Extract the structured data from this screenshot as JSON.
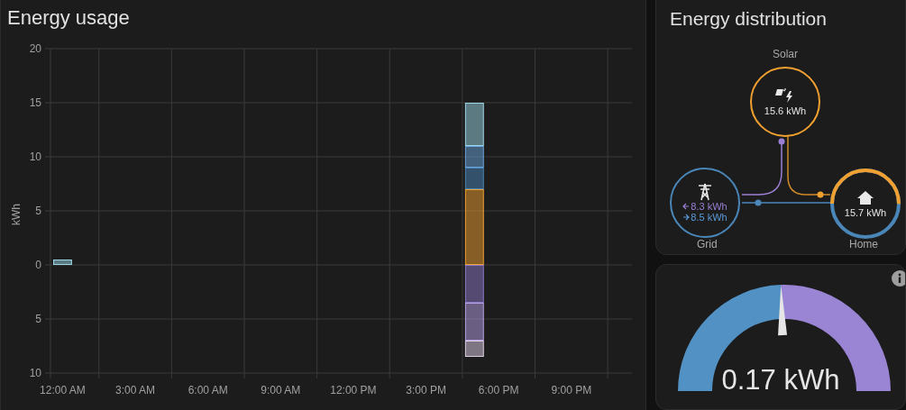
{
  "energy_usage": {
    "title": "Energy usage",
    "chart_data": {
      "type": "bar",
      "stacked": true,
      "ylabel": "kWh",
      "x": [
        0,
        17
      ],
      "xticks": [
        {
          "value": 0,
          "label": "12:00 AM"
        },
        {
          "value": 3,
          "label": "3:00 AM"
        },
        {
          "value": 6,
          "label": "6:00 AM"
        },
        {
          "value": 9,
          "label": "9:00 AM"
        },
        {
          "value": 12,
          "label": "12:00 PM"
        },
        {
          "value": 15,
          "label": "3:00 PM"
        },
        {
          "value": 18,
          "label": "6:00 PM"
        },
        {
          "value": 21,
          "label": "9:00 PM"
        }
      ],
      "xlim": [
        -0.5,
        23.5
      ],
      "ylim": [
        -10,
        20
      ],
      "grid": true,
      "yticks": [
        {
          "value": -10,
          "label": "10"
        },
        {
          "value": -5,
          "label": "5"
        },
        0,
        5,
        10,
        15,
        20
      ],
      "series": [
        {
          "color": "#f0a030",
          "values": [
            null,
            7
          ]
        },
        {
          "color": "#4a86b8",
          "values": [
            null,
            2
          ]
        },
        {
          "color": "#6aa4dc",
          "values": [
            null,
            2
          ]
        },
        {
          "color": "#9cd8e8",
          "values": [
            0.5,
            4
          ]
        },
        {
          "color": "#8c78c8",
          "values": [
            null,
            -3.5
          ]
        },
        {
          "color": "#b8a0e8",
          "values": [
            null,
            -3.5
          ]
        },
        {
          "color": "#e0d0e8",
          "values": [
            null,
            -1.5
          ]
        }
      ]
    }
  },
  "energy_distribution": {
    "title": "Energy distribution",
    "solar": {
      "label": "Solar",
      "value": "15.6 kWh"
    },
    "grid": {
      "label": "Grid",
      "from_grid": "8.3 kWh",
      "to_grid": "8.5 kWh"
    },
    "home": {
      "label": "Home",
      "value": "15.7 kWh",
      "level": 0.5
    }
  },
  "gauge": {
    "value": "0.17 kWh",
    "level": 0.49
  }
}
